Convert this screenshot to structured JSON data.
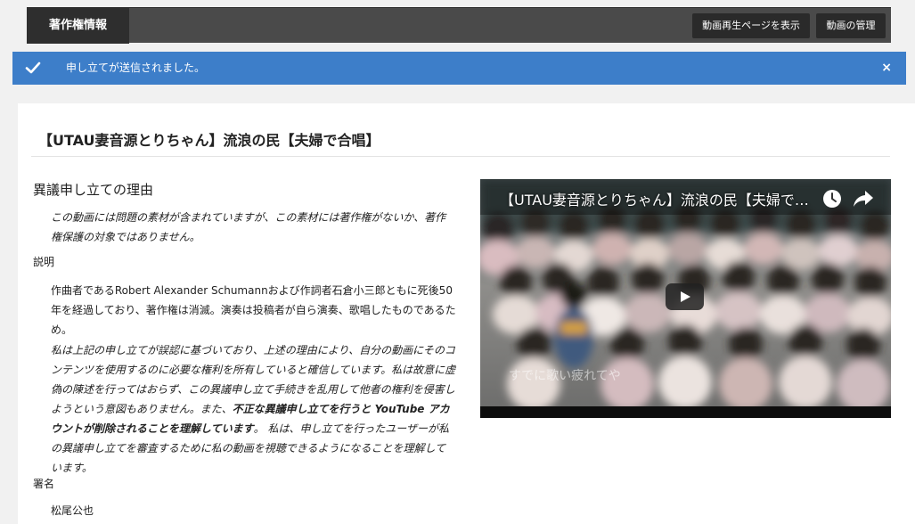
{
  "header": {
    "tab_label": "著作権情報",
    "view_video_button": "動画再生ページを表示",
    "manage_video_button": "動画の管理"
  },
  "alert": {
    "message": "申し立てが送信されました。",
    "close_glyph": "×",
    "color": "#3d7ec9"
  },
  "page": {
    "title": "【UTAU妻音源とりちゃん】流浪の民【夫婦で合唱】",
    "section_title": "異議申し立ての理由",
    "reason": "この動画には問題の素材が含まれていますが、この素材には著作権がないか、著作権保護の対象ではありません。",
    "explanation_label": "説明",
    "explanation": "作曲者であるRobert Alexander Schumannおよび作詞者石倉小三郎ともに死後50年を経過しており、著作権は消滅。演奏は投稿者が自ら演奏、歌唱したものであるため。",
    "declaration_part1": "私は上記の申し立てが誤認に基づいており、上述の理由により、自分の動画にそのコンテンツを使用するのに必要な権利を所有していると確信しています。私は故意に虚偽の陳述を行ってはおらず、この異議申し立て手続きを乱用して他者の権利を侵害しようという意図もありません。また、",
    "declaration_bold": "不正な異議申し立てを行うと YouTube アカウントが削除されることを理解しています",
    "declaration_part2": "。 私は、申し立てを行ったユーザーが私の異議申し立てを審査するために私の動画を視聴できるようになることを理解しています。",
    "signature_label": "署名",
    "signature": "松尾公也"
  },
  "video": {
    "title": "【UTAU妻音源とりちゃん】流浪の民【夫婦で合唱】",
    "caption": "すでに歌い疲れてや",
    "icons": [
      "check-icon",
      "close-icon",
      "watch-later-icon",
      "share-icon",
      "play-icon"
    ]
  }
}
